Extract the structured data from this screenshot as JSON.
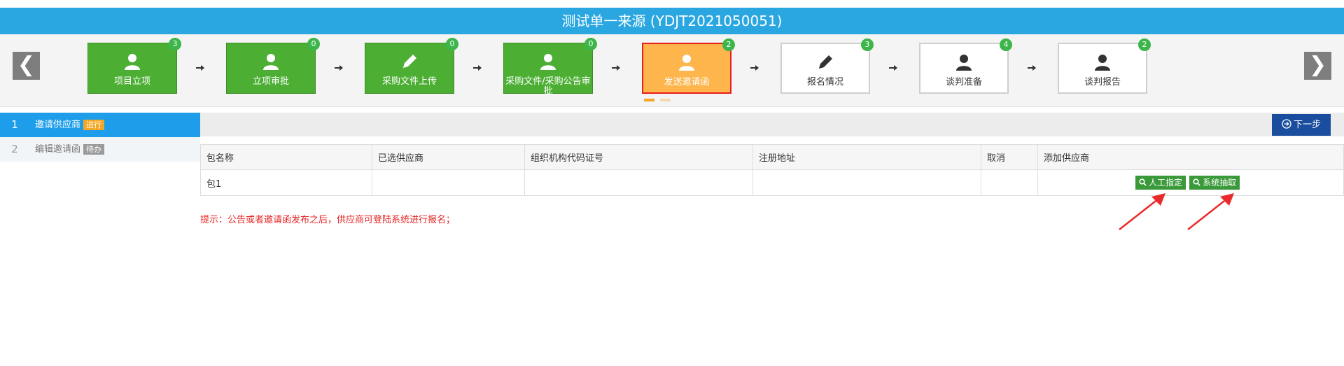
{
  "title": "测试单一来源 (YDJT2021050051)",
  "nav_prev_glyph": "❮",
  "nav_next_glyph": "❯",
  "steps": [
    {
      "label": "项目立项",
      "badge": "3",
      "icon": "user-icon",
      "state": "done"
    },
    {
      "label": "立项审批",
      "badge": "0",
      "icon": "user-icon",
      "state": "done"
    },
    {
      "label": "采购文件上传",
      "badge": "0",
      "icon": "pencil-icon",
      "state": "done"
    },
    {
      "label": "采购文件/采购公告审批",
      "badge": "0",
      "icon": "user-icon",
      "state": "done"
    },
    {
      "label": "发送邀请函",
      "badge": "2",
      "icon": "user-icon",
      "state": "active"
    },
    {
      "label": "报名情况",
      "badge": "3",
      "icon": "pencil-icon",
      "state": "todo"
    },
    {
      "label": "谈判准备",
      "badge": "4",
      "icon": "user-icon",
      "state": "todo"
    },
    {
      "label": "谈判报告",
      "badge": "2",
      "icon": "user-icon",
      "state": "todo"
    }
  ],
  "sub_steps": [
    {
      "num": "1",
      "label": "邀请供应商",
      "tag": "进行"
    },
    {
      "num": "2",
      "label": "编辑邀请函",
      "tag": "待办"
    }
  ],
  "next_button": "下一步",
  "table": {
    "headers": [
      "包名称",
      "已选供应商",
      "组织机构代码证号",
      "注册地址",
      "取消",
      "添加供应商"
    ],
    "rows": [
      {
        "package": "包1",
        "supplier": "",
        "org_code": "",
        "address": "",
        "cancel": ""
      }
    ],
    "manual_button": "人工指定",
    "system_button": "系统抽取"
  },
  "hint": "提示：公告或者邀请函发布之后，供应商可登陆系统进行报名；",
  "colors": {
    "title_bar": "#2aa7e1",
    "step_done": "#4caf34",
    "step_active": "#fdb54c",
    "step_active_border": "#ea1c1c",
    "badge": "#3cb54a",
    "next_button": "#1a4d9e",
    "hint": "#e52222",
    "annotation_arrow": "#ea2a2a",
    "substep_active": "#1e9eea",
    "tag_active": "#f5a623",
    "tag_pending": "#9a9a9a"
  }
}
